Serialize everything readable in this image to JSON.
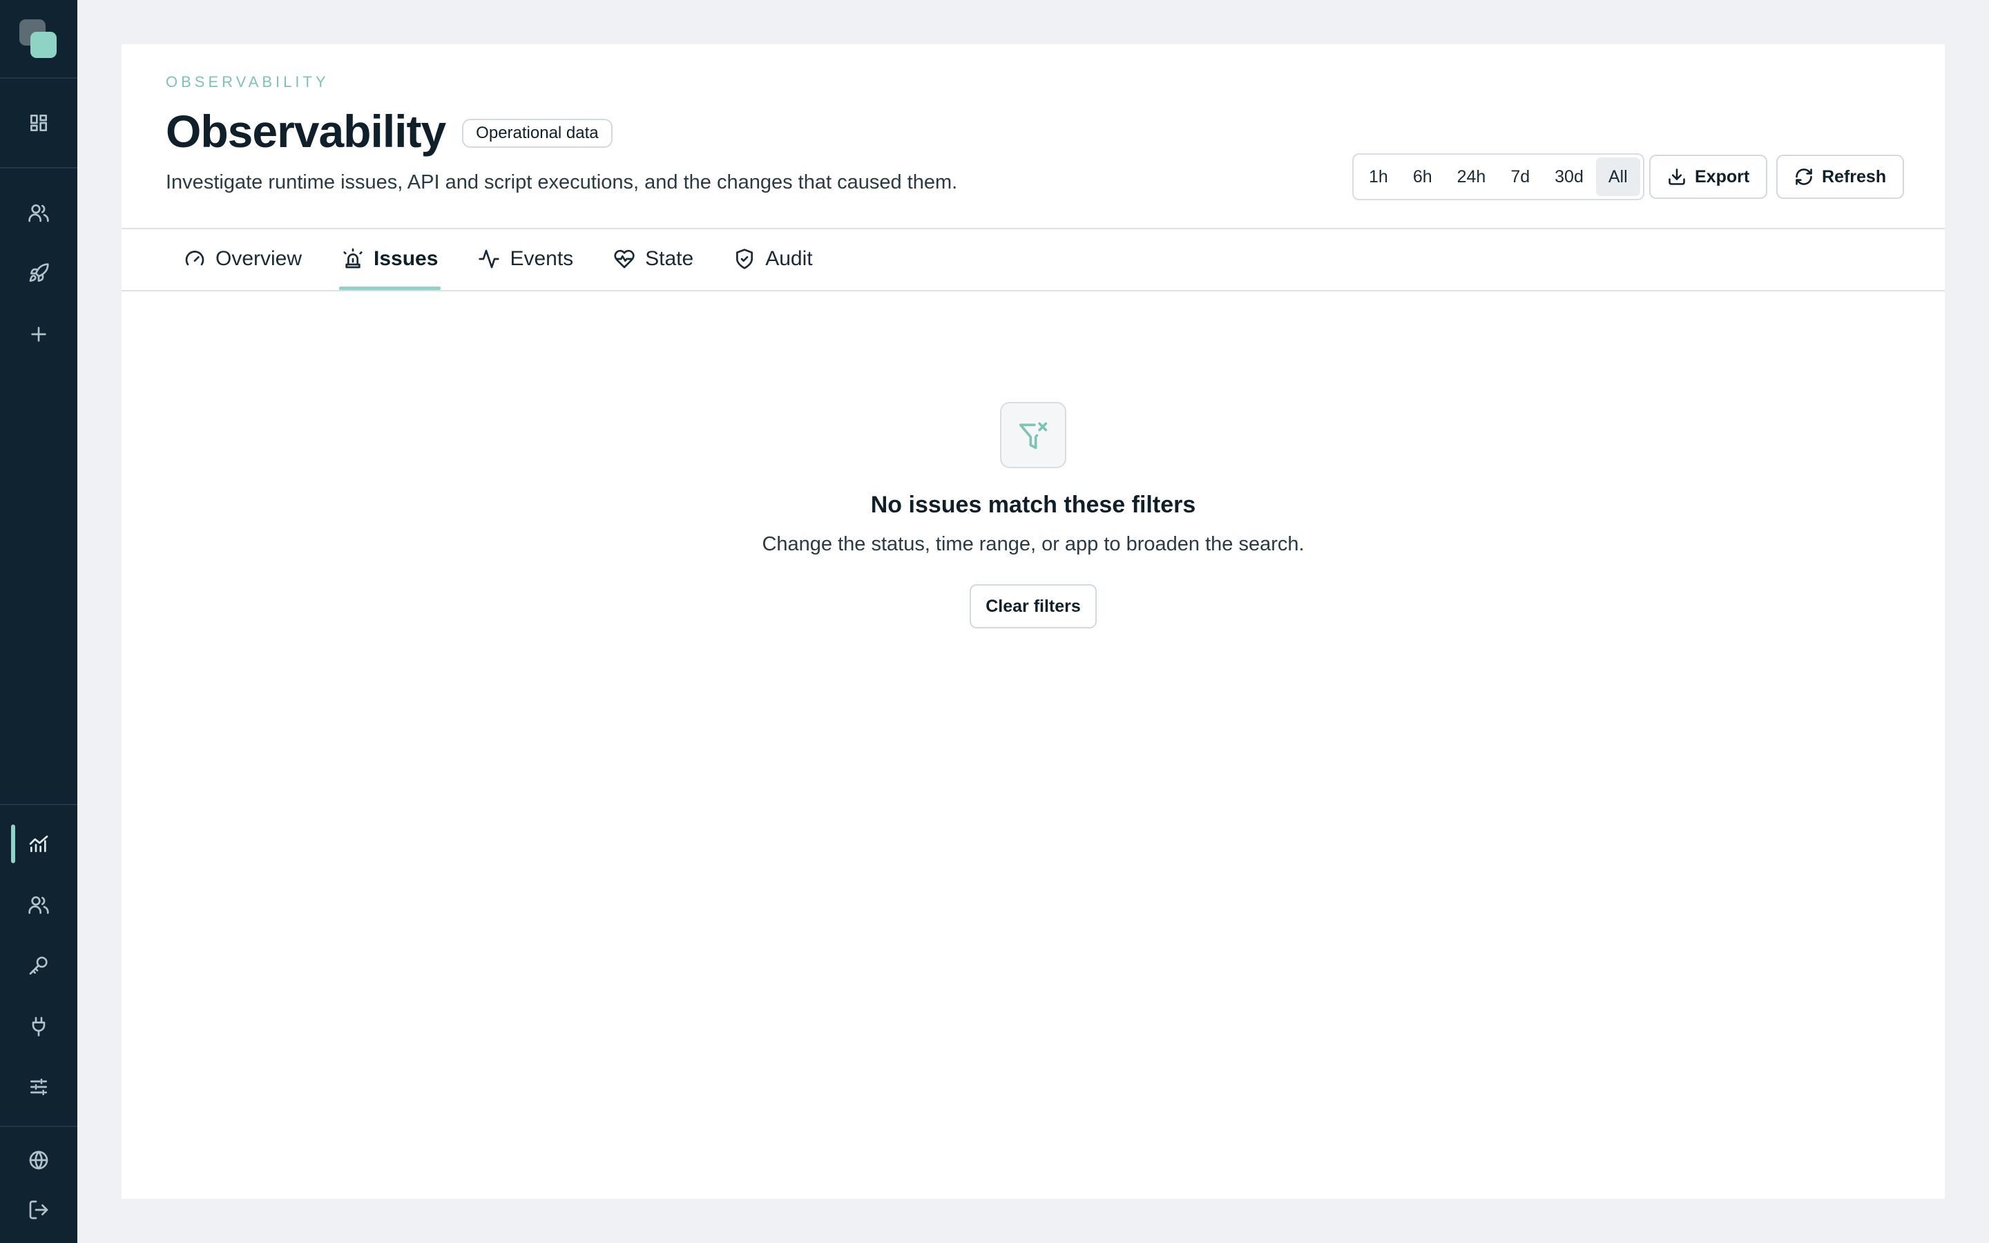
{
  "sidebar": {
    "top_items": [
      {
        "icon": "dashboard-icon",
        "label": ""
      },
      {
        "icon": "users-icon",
        "label": ""
      },
      {
        "icon": "rocket-icon",
        "label": ""
      },
      {
        "icon": "plus-icon",
        "label": ""
      }
    ],
    "bottom_items": [
      {
        "icon": "analytics-icon",
        "active": true
      },
      {
        "icon": "team-icon",
        "active": false
      },
      {
        "icon": "key-icon",
        "active": false
      },
      {
        "icon": "plug-icon",
        "active": false
      },
      {
        "icon": "sliders-icon",
        "active": false
      },
      {
        "icon": "globe-icon",
        "active": false
      },
      {
        "icon": "logout-icon",
        "active": false
      }
    ]
  },
  "header": {
    "eyebrow": "OBSERVABILITY",
    "title": "Observability",
    "badge": "Operational data",
    "subtitle": "Investigate runtime issues, API and script executions, and the changes that caused them."
  },
  "time_ranges": {
    "options": [
      "1h",
      "6h",
      "24h",
      "7d",
      "30d",
      "All"
    ],
    "selected": "All"
  },
  "actions": {
    "export_label": "Export",
    "refresh_label": "Refresh"
  },
  "tabs": [
    {
      "label": "Overview",
      "icon": "gauge-icon",
      "active": false
    },
    {
      "label": "Issues",
      "icon": "siren-icon",
      "active": true
    },
    {
      "label": "Events",
      "icon": "activity-icon",
      "active": false
    },
    {
      "label": "State",
      "icon": "heart-pulse-icon",
      "active": false
    },
    {
      "label": "Audit",
      "icon": "shield-check-icon",
      "active": false
    }
  ],
  "empty_state": {
    "icon": "filter-x-icon",
    "title": "No issues match these filters",
    "message": "Change the status, time range, or app to broaden the search.",
    "button_label": "Clear filters"
  },
  "colors": {
    "sidebar_bg": "#0f2430",
    "accent": "#8ed3c4",
    "page_bg": "#eff1f4"
  }
}
